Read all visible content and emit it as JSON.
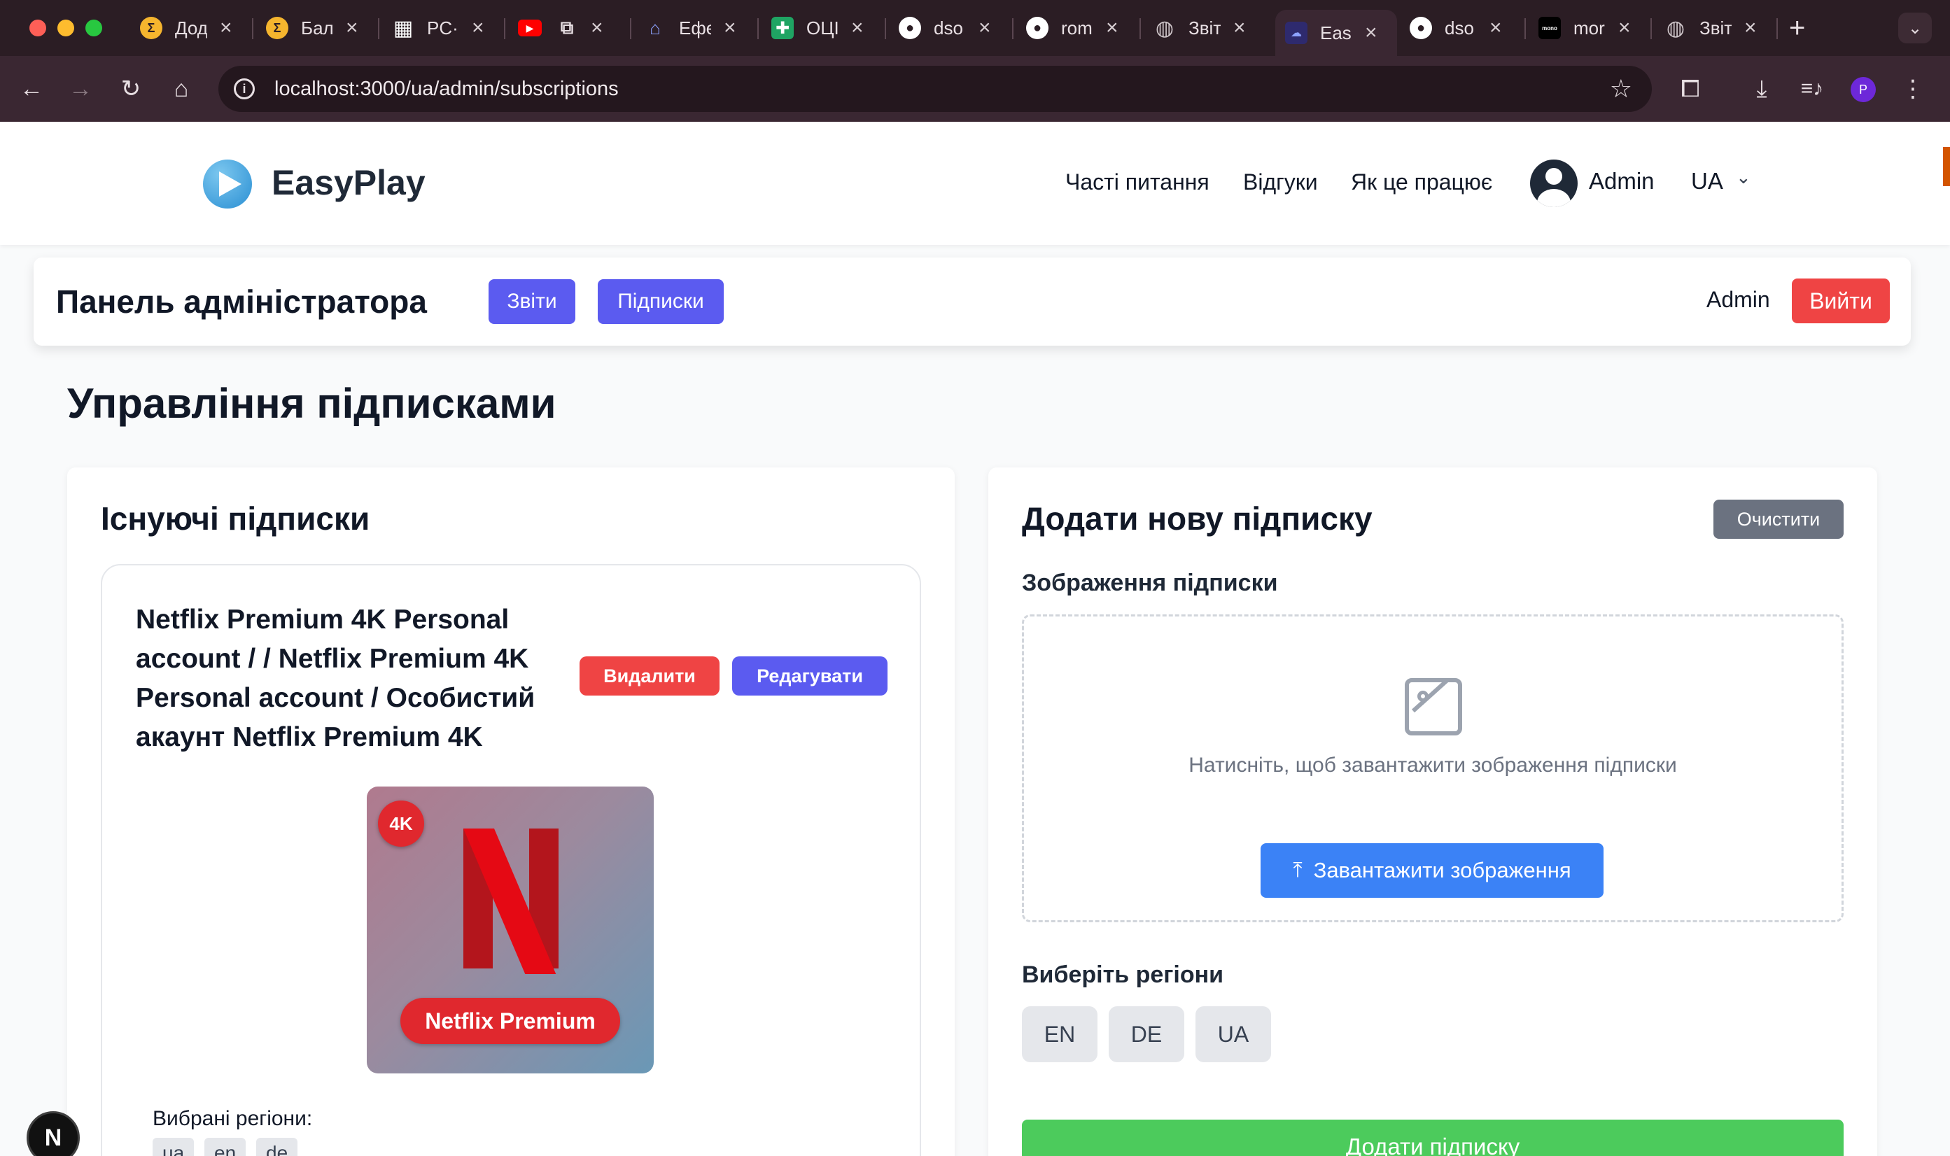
{
  "browser": {
    "tabs": [
      {
        "title": "Дод",
        "favicon": "coin-icon",
        "color": "#f5b52e"
      },
      {
        "title": "Бал",
        "favicon": "coin-icon",
        "color": "#f5b52e"
      },
      {
        "title": "PC·",
        "favicon": "grid-icon",
        "color": "#ffffff"
      },
      {
        "title": "",
        "favicon": "youtube-icon",
        "color": "#ff0000"
      },
      {
        "title": "Ефе",
        "favicon": "shop-icon",
        "color": "#4a5aa8"
      },
      {
        "title": "ОЦІ",
        "favicon": "sheets-icon",
        "color": "#1fa463"
      },
      {
        "title": "dso",
        "favicon": "github-icon",
        "color": "#ffffff"
      },
      {
        "title": "rom",
        "favicon": "github-icon",
        "color": "#ffffff"
      },
      {
        "title": "Звіт",
        "favicon": "globe-icon",
        "color": "#cfc6ca"
      },
      {
        "title": "Eas",
        "favicon": "easyplay-icon",
        "color": "#5b5bf0"
      },
      {
        "title": "dso",
        "favicon": "github-icon",
        "color": "#ffffff"
      },
      {
        "title": "mor",
        "favicon": "mono-icon",
        "color": "#000000"
      },
      {
        "title": "Звіт",
        "favicon": "globe-icon",
        "color": "#cfc6ca"
      }
    ],
    "url": "localhost:3000/ua/admin/subscriptions",
    "profile_initial": "P"
  },
  "header": {
    "brand": "EasyPlay",
    "nav": [
      "Часті питання",
      "Відгуки",
      "Як це працює"
    ],
    "user": "Admin",
    "lang": "UA"
  },
  "adminbar": {
    "title": "Панель адміністратора",
    "reports": "Звіти",
    "subscriptions": "Підписки",
    "user": "Admin",
    "logout": "Вийти"
  },
  "page": {
    "title": "Управління підписками"
  },
  "existing": {
    "heading": "Існуючі підписки",
    "items": [
      {
        "title": "Netflix Premium 4K Personal account / / Netflix Premium 4K Personal account / Особистий акаунт Netflix Premium 4K",
        "delete": "Видалити",
        "edit": "Редагувати",
        "badge": "4K",
        "image_label": "Netflix Premium",
        "regions_label": "Вибрані регіони:",
        "regions": [
          "ua",
          "en",
          "de"
        ]
      }
    ]
  },
  "form": {
    "heading": "Додати нову підписку",
    "clear": "Очистити",
    "image_label": "Зображення підписки",
    "dropzone_text": "Натисніть, щоб завантажити зображення підписки",
    "upload": "Завантажити зображення",
    "regions_label": "Виберіть регіони",
    "regions": [
      "EN",
      "DE",
      "UA"
    ],
    "submit": "Додати підписку"
  },
  "colors": {
    "primary": "#5b5bf0",
    "danger": "#ef4444",
    "success": "#4ccb5c",
    "upload": "#3b82f6"
  }
}
